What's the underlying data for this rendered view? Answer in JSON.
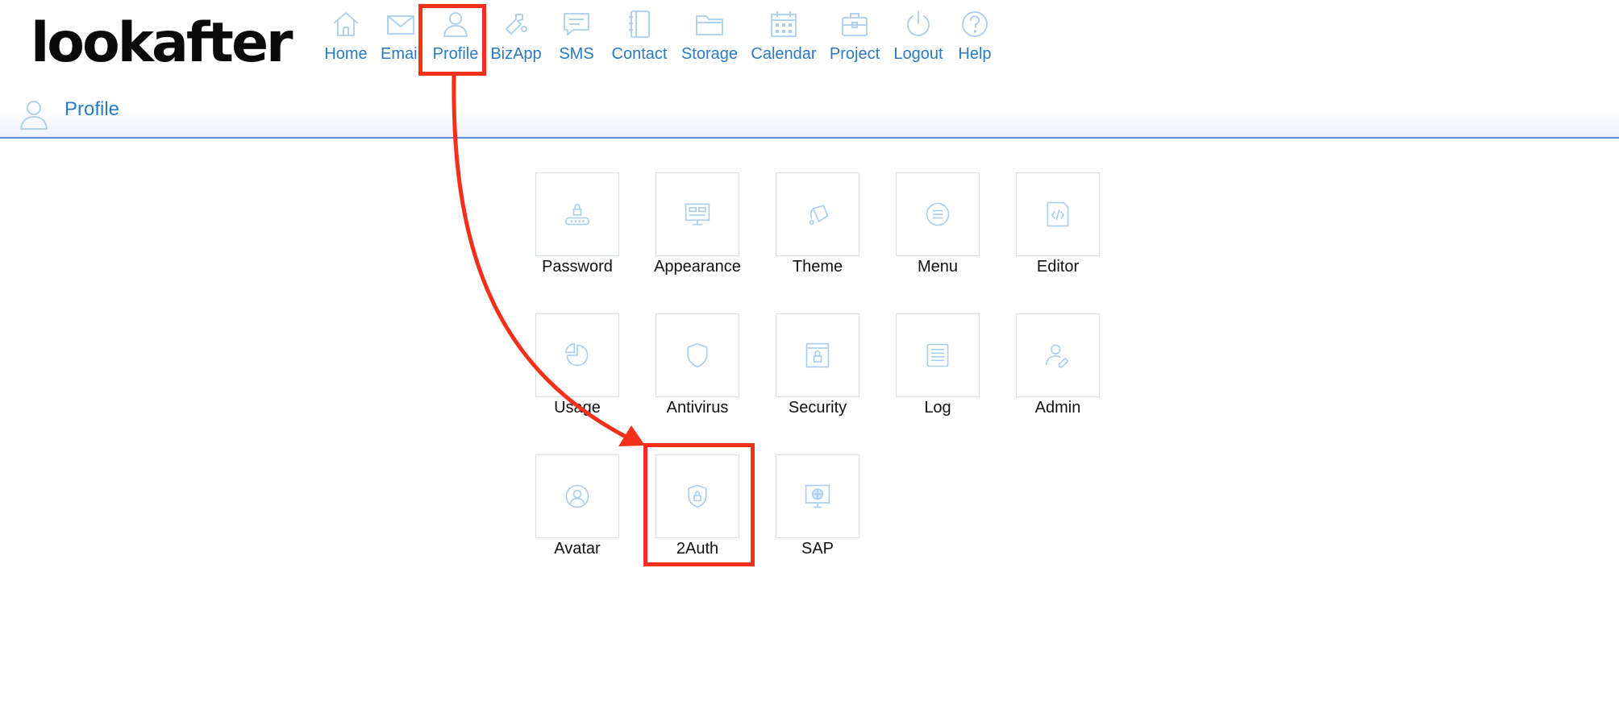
{
  "logo": "lookafter",
  "nav": [
    {
      "label": "Home",
      "icon": "home-icon"
    },
    {
      "label": "Email",
      "icon": "email-icon"
    },
    {
      "label": "Profile",
      "icon": "profile-icon"
    },
    {
      "label": "BizApp",
      "icon": "bizapp-icon"
    },
    {
      "label": "SMS",
      "icon": "sms-icon"
    },
    {
      "label": "Contact",
      "icon": "contact-icon"
    },
    {
      "label": "Storage",
      "icon": "storage-folder-icon"
    },
    {
      "label": "Calendar",
      "icon": "calendar-icon"
    },
    {
      "label": "Project",
      "icon": "project-briefcase-icon"
    },
    {
      "label": "Logout",
      "icon": "power-icon"
    },
    {
      "label": "Help",
      "icon": "help-icon"
    }
  ],
  "page": {
    "title": "Profile",
    "icon": "profile-icon"
  },
  "tiles": [
    {
      "label": "Password",
      "icon": "password-lock-icon"
    },
    {
      "label": "Appearance",
      "icon": "appearance-monitor-icon"
    },
    {
      "label": "Theme",
      "icon": "theme-paint-icon"
    },
    {
      "label": "Menu",
      "icon": "menu-list-icon"
    },
    {
      "label": "Editor",
      "icon": "editor-code-icon"
    },
    {
      "label": "Usage",
      "icon": "usage-pie-icon"
    },
    {
      "label": "Antivirus",
      "icon": "antivirus-shield-icon"
    },
    {
      "label": "Security",
      "icon": "security-lock-window-icon"
    },
    {
      "label": "Log",
      "icon": "log-document-icon"
    },
    {
      "label": "Admin",
      "icon": "admin-user-icon"
    },
    {
      "label": "Avatar",
      "icon": "avatar-icon"
    },
    {
      "label": "2Auth",
      "icon": "two-auth-shield-lock-icon"
    },
    {
      "label": "SAP",
      "icon": "sap-globe-monitor-icon"
    }
  ],
  "colors": {
    "accent": "#2a7ac4",
    "icon": "#a9cdec",
    "annotation": "#f5301a",
    "divider": "#5b8ed8"
  }
}
